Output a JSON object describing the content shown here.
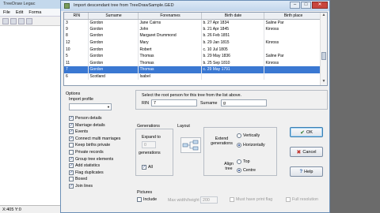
{
  "background_app": {
    "title": "TreeDraw Legac",
    "menu": [
      "File",
      "Edit",
      "Forma"
    ],
    "status": "X:405 Y:0"
  },
  "dialog": {
    "title": "Import descendant tree from TreeDrawSample.GED",
    "window_buttons": {
      "minimize": "–",
      "maximize": "□",
      "close": "✕"
    }
  },
  "grid": {
    "columns": [
      "RIN",
      "Surname",
      "Forenames",
      "Birth date",
      "Birth place"
    ],
    "rows": [
      {
        "rin": "3",
        "surname": "Gordon",
        "forenames": "Jane Cairns",
        "birth_date": "b. 27 Apr 1834",
        "birth_place": "Saline Par",
        "selected": false
      },
      {
        "rin": "9",
        "surname": "Gordon",
        "forenames": "John",
        "birth_date": "b. 21 Apr 1845",
        "birth_place": "Kinross",
        "selected": false
      },
      {
        "rin": "8",
        "surname": "Gordon",
        "forenames": "Margaret Drummond",
        "birth_date": "b. 26 Feb 1851",
        "birth_place": "",
        "selected": false
      },
      {
        "rin": "12",
        "surname": "Gordon",
        "forenames": "Mary",
        "birth_date": "b. 29 Jan 1815",
        "birth_place": "Kinross",
        "selected": false
      },
      {
        "rin": "10",
        "surname": "Gordon",
        "forenames": "Robert",
        "birth_date": "c. 10 Jul 1805",
        "birth_place": "",
        "selected": false
      },
      {
        "rin": "5",
        "surname": "Gordon",
        "forenames": "Thomas",
        "birth_date": "b. 29 May 1836",
        "birth_place": "Saline Par",
        "selected": false
      },
      {
        "rin": "11",
        "surname": "Gordon",
        "forenames": "Thomas",
        "birth_date": "b. 25 Sep 1810",
        "birth_place": "Kinross",
        "selected": false
      },
      {
        "rin": "7",
        "surname": "Gordon",
        "forenames": "Thomas",
        "birth_date": "c. 29 May 1791",
        "birth_place": "",
        "selected": true
      },
      {
        "rin": "6",
        "surname": "Scotland",
        "forenames": "Isabel",
        "birth_date": "",
        "birth_place": "",
        "selected": false
      }
    ]
  },
  "options": {
    "heading": "Options",
    "import_profile_label": "Import profile",
    "import_profile_value": "",
    "checkboxes": [
      {
        "label": "Person details",
        "checked": true
      },
      {
        "label": "Marriage details",
        "checked": true
      },
      {
        "label": "Events",
        "checked": true
      },
      {
        "label": "Connect multi marriages",
        "checked": true
      },
      {
        "label": "Keep births private",
        "checked": false
      },
      {
        "label": "Private records",
        "checked": false
      },
      {
        "label": "Group tree elements",
        "checked": true
      },
      {
        "label": "Add statistics",
        "checked": true
      },
      {
        "label": "Flag duplicates",
        "checked": true
      },
      {
        "label": "Boxed",
        "checked": false
      },
      {
        "label": "Join lines",
        "checked": true
      }
    ]
  },
  "root": {
    "prompt": "Select the root person for this tree from the list above.",
    "rin_label": "RIN",
    "rin_value": "7",
    "surname_label": "Surname",
    "surname_value": "g"
  },
  "generations": {
    "heading": "Generations",
    "expand_label": "Expand to",
    "expand_value": "0",
    "generations_label": "generations",
    "all_label": "All",
    "all_checked": true
  },
  "layout": {
    "heading": "Layout",
    "extend_label": "Extend generations",
    "extend_options": [
      {
        "label": "Vertically",
        "selected": false
      },
      {
        "label": "Horizontally",
        "selected": true
      }
    ],
    "align_label": "Align tree",
    "align_options": [
      {
        "label": "Top",
        "selected": false
      },
      {
        "label": "Centre",
        "selected": true
      }
    ]
  },
  "buttons": {
    "ok": "OK",
    "cancel": "Cancel",
    "help": "Help"
  },
  "pictures": {
    "heading": "Pictures",
    "include_label": "Include",
    "max_width_label": "Max width/height",
    "max_width_value": "200",
    "must_have_label": "Must have print flag",
    "full_resolution_label": "Full resolution"
  }
}
